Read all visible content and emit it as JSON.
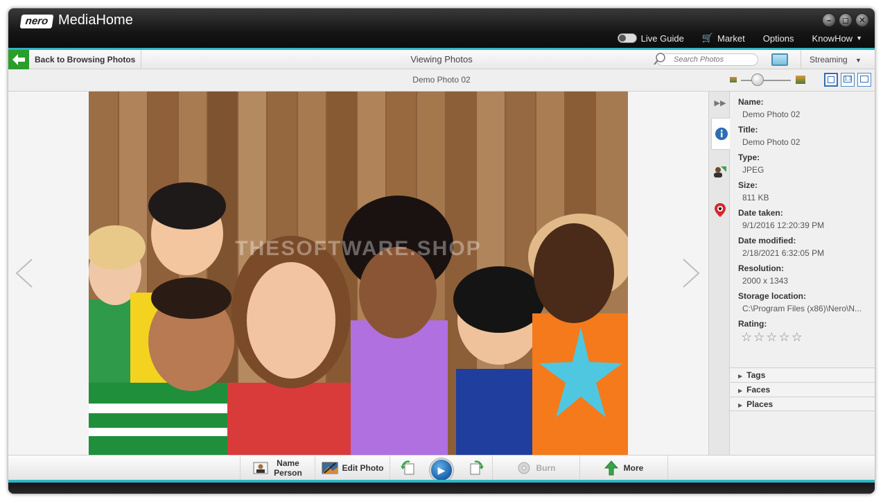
{
  "app": {
    "logo": "nero",
    "title": "MediaHome"
  },
  "window_controls": {
    "minimize": "–",
    "restore": "◻",
    "close": "✕"
  },
  "top_menu": {
    "live_guide": "Live Guide",
    "market": "Market",
    "options": "Options",
    "knowhow": "KnowHow"
  },
  "toolbar": {
    "back_label": "Back to Browsing Photos",
    "viewing_label": "Viewing Photos",
    "search_placeholder": "Search Photos",
    "streaming_label": "Streaming"
  },
  "subheader": {
    "photo_name": "Demo Photo 02"
  },
  "photo": {
    "watermark": "THESOFTWARE.SHOP"
  },
  "info": {
    "name_label": "Name:",
    "name_value": "Demo Photo 02",
    "title_label": "Title:",
    "title_value": "Demo Photo 02",
    "type_label": "Type:",
    "type_value": "JPEG",
    "size_label": "Size:",
    "size_value": "811 KB",
    "date_taken_label": "Date taken:",
    "date_taken_value": "9/1/2016 12:20:39 PM",
    "date_modified_label": "Date modified:",
    "date_modified_value": "2/18/2021 6:32:05 PM",
    "resolution_label": "Resolution:",
    "resolution_value": "2000 x 1343",
    "storage_label": "Storage location:",
    "storage_value": "C:\\Program Files (x86)\\Nero\\N...",
    "rating_label": "Rating:",
    "rating_value": 0,
    "rating_max": 5
  },
  "sections": {
    "tags": "Tags",
    "faces": "Faces",
    "places": "Places"
  },
  "bottom": {
    "name_person_line1": "Name",
    "name_person_line2": "Person",
    "edit_photo": "Edit Photo",
    "burn": "Burn",
    "more": "More"
  },
  "colors": {
    "accent": "#2fb6c3",
    "back_green": "#2a9d2a",
    "play_blue": "#1a5fa8",
    "location_red": "#d9262b"
  }
}
